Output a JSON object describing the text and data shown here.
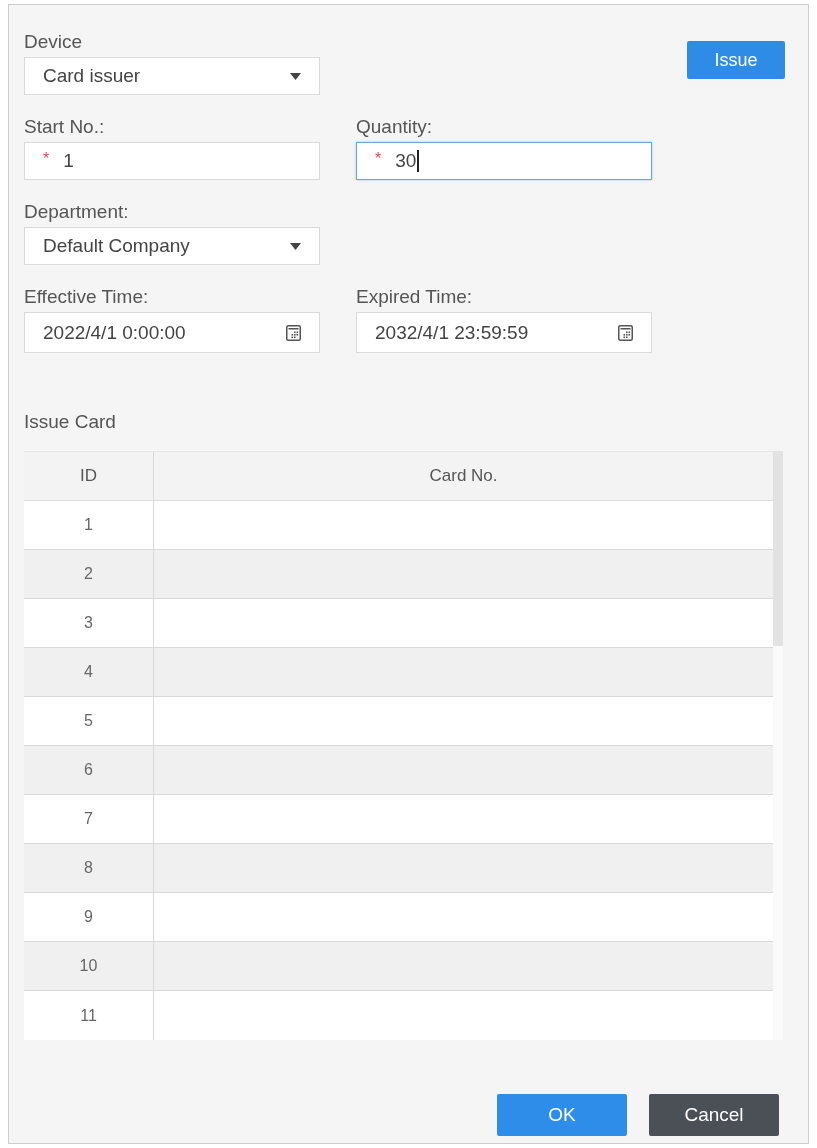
{
  "dialog": {
    "issue_button": {
      "label": "Issue"
    },
    "field_rows": [
      [
        {
          "kind": "select",
          "label": "Device",
          "value": "Card issuer"
        }
      ],
      [
        {
          "kind": "text",
          "label": "Start No.:",
          "required_mark": "*",
          "value": "1",
          "focused": false
        },
        {
          "kind": "text",
          "label": "Quantity:",
          "required_mark": "*",
          "value": "30",
          "focused": true
        }
      ],
      [
        {
          "kind": "select",
          "label": "Department:",
          "value": "Default Company"
        }
      ],
      [
        {
          "kind": "datetime",
          "label": "Effective Time:",
          "value": "2022/4/1 0:00:00"
        },
        {
          "kind": "datetime",
          "label": "Expired Time:",
          "value": "2032/4/1 23:59:59"
        }
      ]
    ],
    "issue_card": {
      "title": "Issue Card",
      "table": {
        "columns": [
          "ID",
          "Card No."
        ],
        "rows": [
          {
            "id": "1"
          },
          {
            "id": "2"
          },
          {
            "id": "3"
          },
          {
            "id": "4"
          },
          {
            "id": "5"
          },
          {
            "id": "6"
          },
          {
            "id": "7"
          },
          {
            "id": "8"
          },
          {
            "id": "9"
          },
          {
            "id": "10"
          },
          {
            "id": "11"
          }
        ]
      }
    },
    "footer_buttons": [
      {
        "kind": "primary",
        "label": "OK"
      },
      {
        "kind": "secondary",
        "label": "Cancel"
      }
    ]
  }
}
